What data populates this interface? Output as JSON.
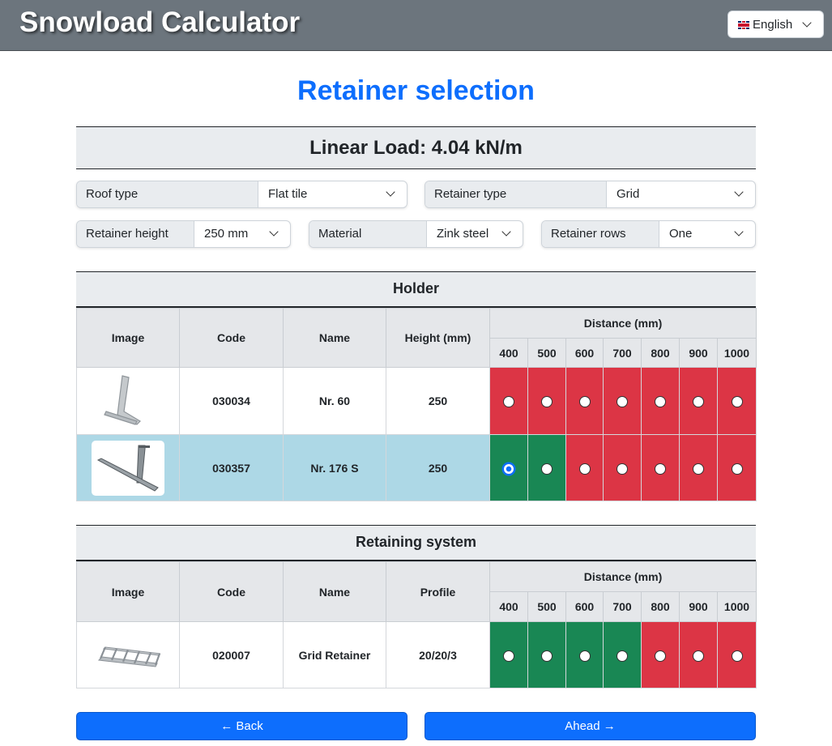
{
  "app": {
    "title": "Snowload Calculator"
  },
  "language": {
    "selected": "English"
  },
  "page": {
    "title": "Retainer selection"
  },
  "linear_load": "Linear Load: 4.04 kN/m",
  "filters": {
    "roof_type": {
      "label": "Roof type",
      "value": "Flat tile"
    },
    "retainer_type": {
      "label": "Retainer type",
      "value": "Grid"
    },
    "retainer_height": {
      "label": "Retainer height",
      "value": "250 mm"
    },
    "material": {
      "label": "Material",
      "value": "Zink steel"
    },
    "retainer_rows": {
      "label": "Retainer rows",
      "value": "One"
    }
  },
  "holder": {
    "title": "Holder",
    "headers": {
      "image": "Image",
      "code": "Code",
      "name": "Name",
      "height": "Height (mm)",
      "distance": "Distance (mm)"
    },
    "distances": [
      "400",
      "500",
      "600",
      "700",
      "800",
      "900",
      "1000"
    ],
    "rows": [
      {
        "code": "030034",
        "name": "Nr. 60",
        "height": "250",
        "status": [
          "red",
          "red",
          "red",
          "red",
          "red",
          "red",
          "red"
        ],
        "checked": -1
      },
      {
        "code": "030357",
        "name": "Nr. 176 S",
        "height": "250",
        "status": [
          "green",
          "green",
          "red",
          "red",
          "red",
          "red",
          "red"
        ],
        "checked": 0
      }
    ]
  },
  "retaining_system": {
    "title": "Retaining system",
    "headers": {
      "image": "Image",
      "code": "Code",
      "name": "Name",
      "profile": "Profile",
      "distance": "Distance (mm)"
    },
    "distances": [
      "400",
      "500",
      "600",
      "700",
      "800",
      "900",
      "1000"
    ],
    "rows": [
      {
        "code": "020007",
        "name": "Grid Retainer",
        "profile": "20/20/3",
        "status": [
          "green",
          "green",
          "green",
          "green",
          "red",
          "red",
          "red"
        ],
        "checked": -1
      }
    ]
  },
  "nav": {
    "back": "Back",
    "ahead": "Ahead"
  },
  "colors": {
    "accent": "#0d6efd",
    "ok": "#198754",
    "bad": "#dc3545",
    "selected_row": "#add8e6"
  }
}
